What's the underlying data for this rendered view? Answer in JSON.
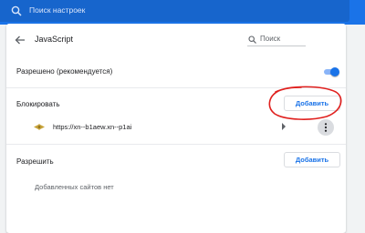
{
  "header": {
    "search_placeholder": "Поиск настроек"
  },
  "page": {
    "title": "JavaScript",
    "search_placeholder": "Поиск"
  },
  "allowed_setting": {
    "label": "Разрешено (рекомендуется)",
    "enabled": true
  },
  "block_section": {
    "label": "Блокировать",
    "add_button": "Добавить",
    "sites": [
      {
        "url": "https://xn--b1aew.xn--p1ai"
      }
    ]
  },
  "allow_section": {
    "label": "Разрешить",
    "add_button": "Добавить",
    "empty_text": "Добавленных сайтов нет"
  },
  "colors": {
    "accent": "#1a73e8",
    "annotation": "#e0201e"
  }
}
